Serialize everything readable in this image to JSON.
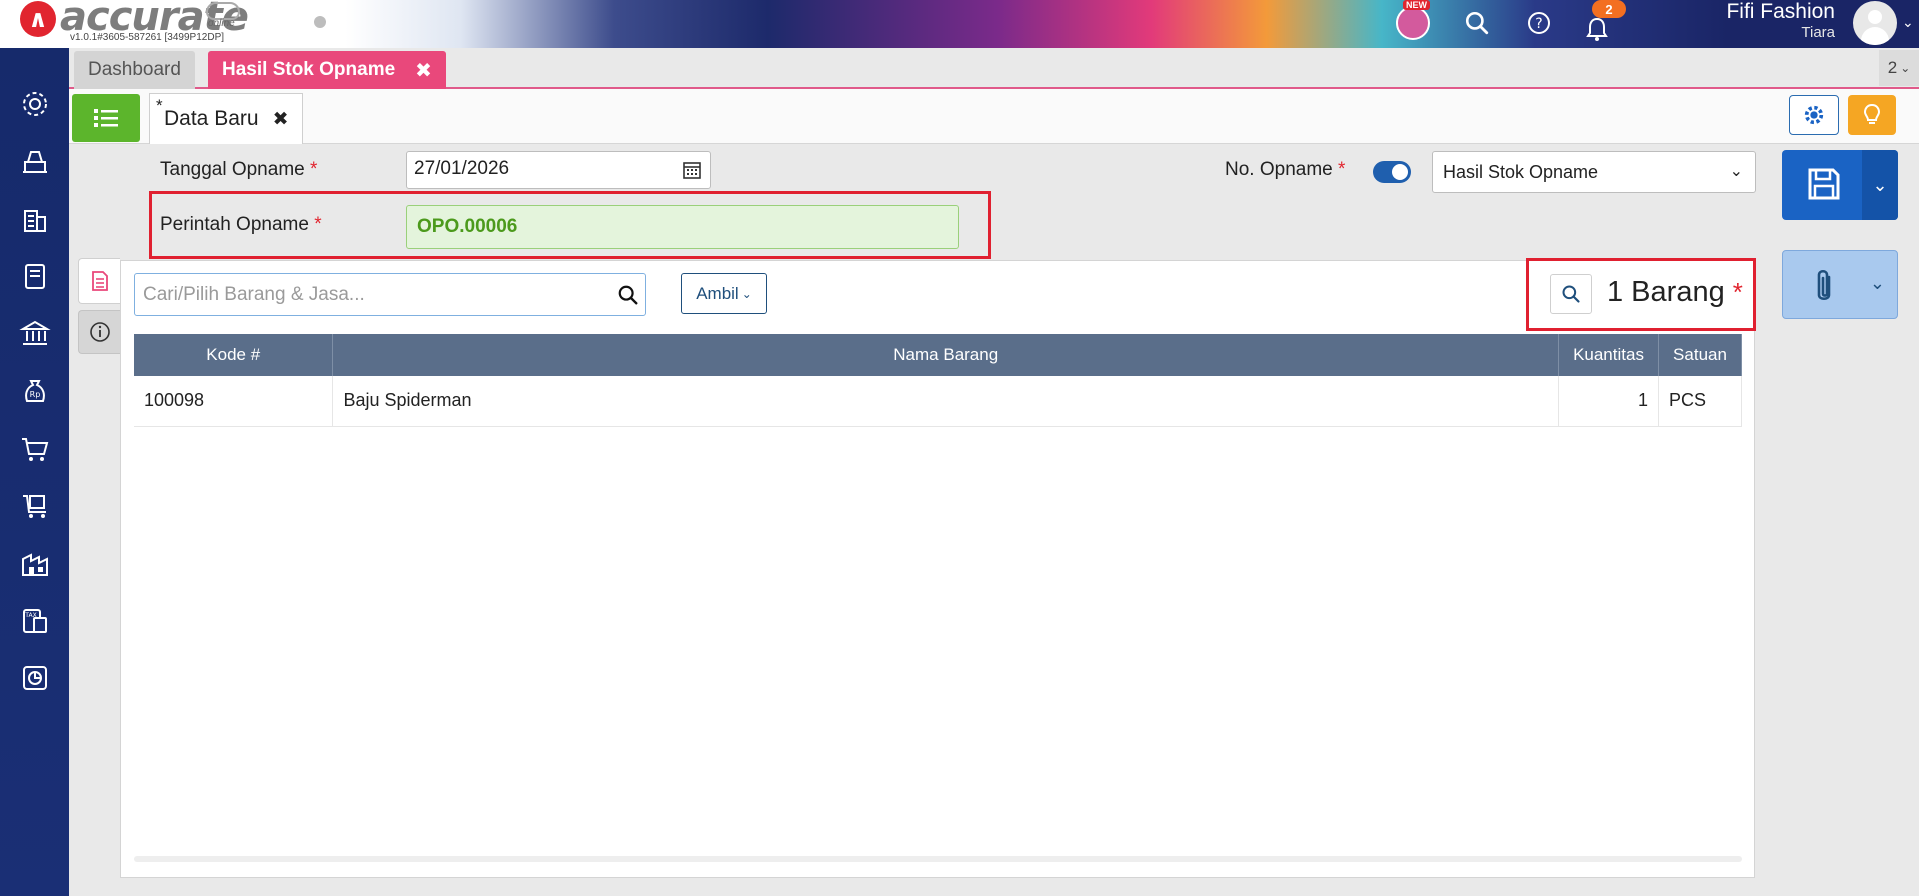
{
  "app": {
    "logo_text": "accurate",
    "logo_sub": "online",
    "version": "v1.0.1#3605-587261 [3499P12DP]",
    "new_badge": "NEW",
    "notification_count": "2",
    "company_name": "Fifi Fashion",
    "user_name": "Tiara",
    "colors": {
      "accent": "#e9487b",
      "primary": "#1a63c4",
      "green": "#5cb52c",
      "required": "#e1252f"
    }
  },
  "tabs": {
    "items": [
      {
        "label": "Dashboard"
      },
      {
        "label": "Hasil Stok Opname",
        "close": "✖"
      }
    ],
    "more_count": "2"
  },
  "subtab": {
    "star": "*",
    "label": "Data Baru",
    "close": "✖"
  },
  "form": {
    "tanggal_label": "Tanggal Opname",
    "tanggal_value": "27/01/2026",
    "required_mark": "*",
    "no_label": "No. Opname",
    "no_select_value": "Hasil Stok Opname",
    "perintah_label": "Perintah Opname",
    "perintah_value": "OPO.00006"
  },
  "items_panel": {
    "search_placeholder": "Cari/Pilih Barang & Jasa...",
    "ambil_label": "Ambil",
    "count_label": "1 Barang"
  },
  "table": {
    "headers": [
      "Kode #",
      "Nama Barang",
      "Kuantitas",
      "Satuan"
    ],
    "rows": [
      [
        "100098",
        "Baju Spiderman",
        "1",
        "PCS"
      ]
    ]
  }
}
